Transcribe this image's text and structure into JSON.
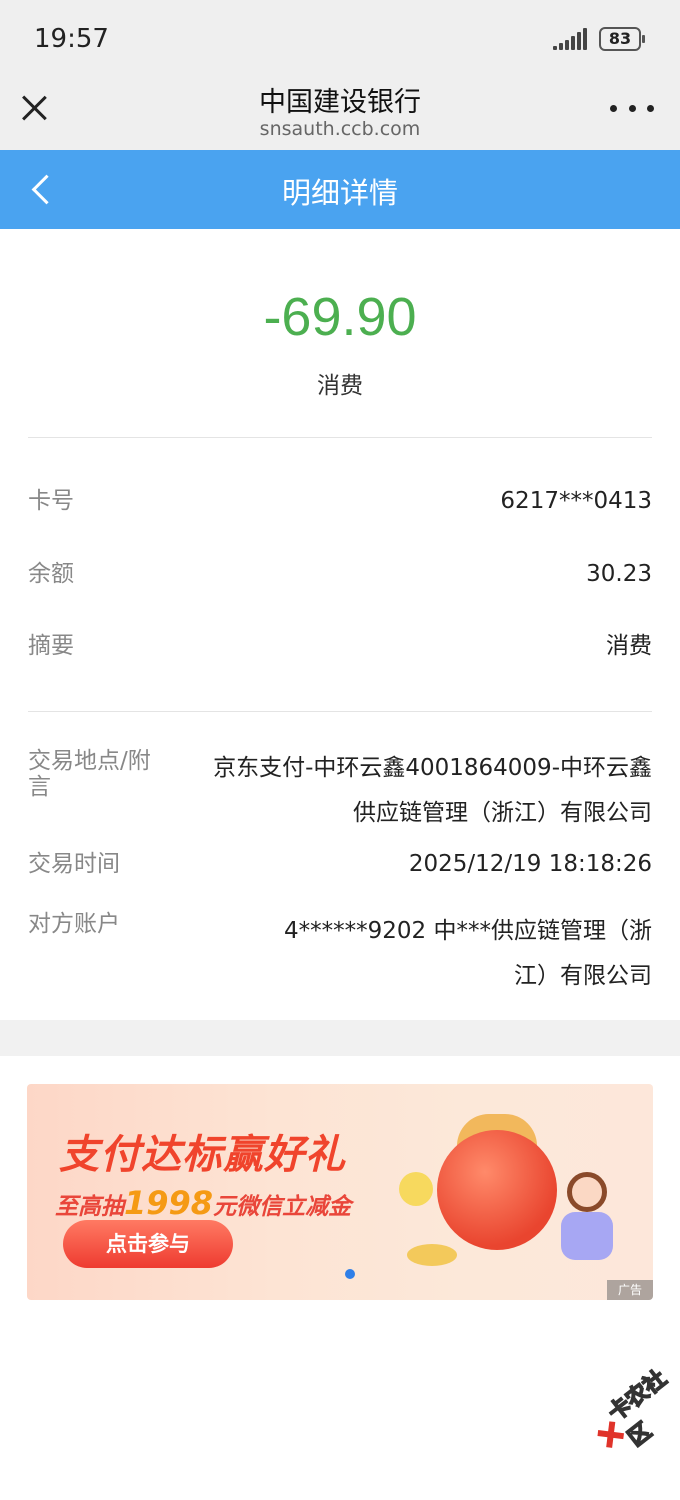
{
  "status_bar": {
    "time": "19:57",
    "battery": "83"
  },
  "browser": {
    "title": "中国建设银行",
    "url": "snsauth.ccb.com"
  },
  "nav": {
    "title": "明细详情"
  },
  "transaction": {
    "amount": "-69.90",
    "type": "消费",
    "amount_color": "#4caf50"
  },
  "details": [
    {
      "label": "卡号",
      "value": "6217***0413"
    },
    {
      "label": "余额",
      "value": "30.23"
    },
    {
      "label": "摘要",
      "value": "消费"
    }
  ],
  "extra": {
    "location_label_line1": "交易地点/附",
    "location_label_line2": "言",
    "location_value_line1": "京东支付-中环云鑫4001864009-中环云鑫",
    "location_value_line2": "供应链管理（浙江）有限公司",
    "time_label": "交易时间",
    "time_value": "2025/12/19 18:18:26",
    "account_label": "对方账户",
    "account_value_line1": "4******9202 中***供应链管理（浙",
    "account_value_line2": "江）有限公司"
  },
  "ad": {
    "title": "支付达标赢好礼",
    "sub_prefix": "至高抽",
    "sub_number": "1998",
    "sub_suffix": "元微信立减金",
    "button": "点击参与",
    "tag": "广告"
  },
  "watermark": "卡农社区",
  "colors": {
    "nav_bar": "#4aa3f0",
    "amount": "#4caf50"
  }
}
